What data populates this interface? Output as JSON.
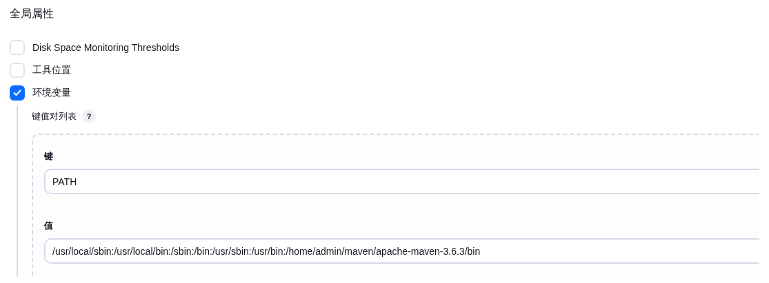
{
  "section_title": "全局属性",
  "options": [
    {
      "label": "Disk Space Monitoring Thresholds",
      "checked": false
    },
    {
      "label": "工具位置",
      "checked": false
    },
    {
      "label": "环境变量",
      "checked": true
    }
  ],
  "env": {
    "list_label": "键值对列表",
    "help": "?",
    "fields": [
      {
        "label": "键",
        "value": "PATH"
      },
      {
        "label": "值",
        "value": "/usr/local/sbin:/usr/local/bin:/sbin:/bin:/usr/sbin:/usr/bin:/home/admin/maven/apache-maven-3.6.3/bin"
      }
    ]
  }
}
